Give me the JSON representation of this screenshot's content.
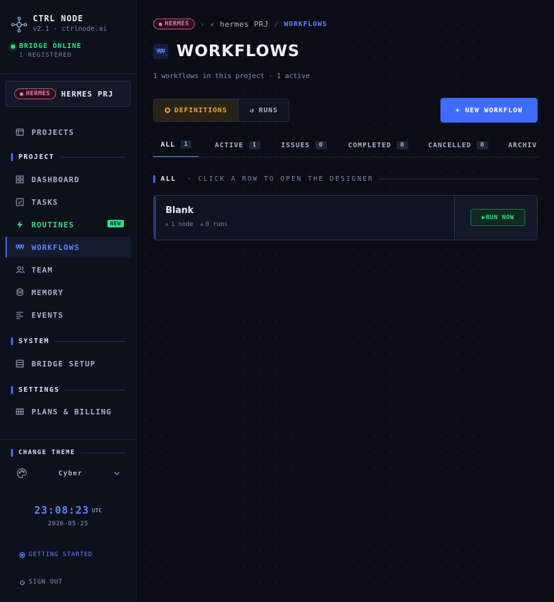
{
  "brand": {
    "name": "CTRL NODE",
    "version_line": "v2.1 · ctrlnode.ai"
  },
  "bridge": {
    "status": "BRIDGE ONLINE",
    "registered": "1 REGISTERED"
  },
  "project_card": {
    "badge": "HERMES",
    "name": "HERMES PRJ"
  },
  "nav": {
    "projects": "PROJECTS",
    "section_project": "PROJECT",
    "dashboard": "DASHBOARD",
    "tasks": "TASKS",
    "routines": "ROUTINES",
    "routines_badge": "NEW",
    "workflows": "WORKFLOWS",
    "team": "TEAM",
    "memory": "MEMORY",
    "events": "EVENTS",
    "section_system": "SYSTEM",
    "bridge_setup": "BRIDGE SETUP",
    "section_settings": "SETTINGS",
    "plans_billing": "PLANS & BILLING"
  },
  "theme": {
    "heading": "CHANGE THEME",
    "value": "Cyber"
  },
  "clock": {
    "time": "23:08:23",
    "zone": "UTC",
    "date": "2026-05-25"
  },
  "links": {
    "getting_started": "GETTING STARTED",
    "sign_out": "SIGN OUT"
  },
  "breadcrumb": {
    "badge": "HERMES",
    "project": "hermes PRJ",
    "current": "WORKFLOWS"
  },
  "page": {
    "title": "WORKFLOWS",
    "subtitle": "1 workflows in this project · 1 active"
  },
  "toggle": {
    "definitions": "DEFINITIONS",
    "runs": "RUNS"
  },
  "new_workflow_label": "+ NEW WORKFLOW",
  "tabs": [
    {
      "label": "ALL",
      "count": "1"
    },
    {
      "label": "ACTIVE",
      "count": "1"
    },
    {
      "label": "ISSUES",
      "count": "0"
    },
    {
      "label": "COMPLETED",
      "count": "0"
    },
    {
      "label": "CANCELLED",
      "count": "0"
    },
    {
      "label": "ARCHIVED",
      "count": ""
    }
  ],
  "list": {
    "heading": "ALL",
    "hint": "· CLICK A ROW TO OPEN THE DESIGNER"
  },
  "workflows": [
    {
      "name": "Blank",
      "nodes": "1 node",
      "runs": "0 runs",
      "action": "▶RUN NOW"
    }
  ],
  "colors": {
    "accent": "#3f6bff",
    "online": "#2fe08a",
    "warning": "#f3a53a",
    "project_badge": "#f07aa3"
  }
}
